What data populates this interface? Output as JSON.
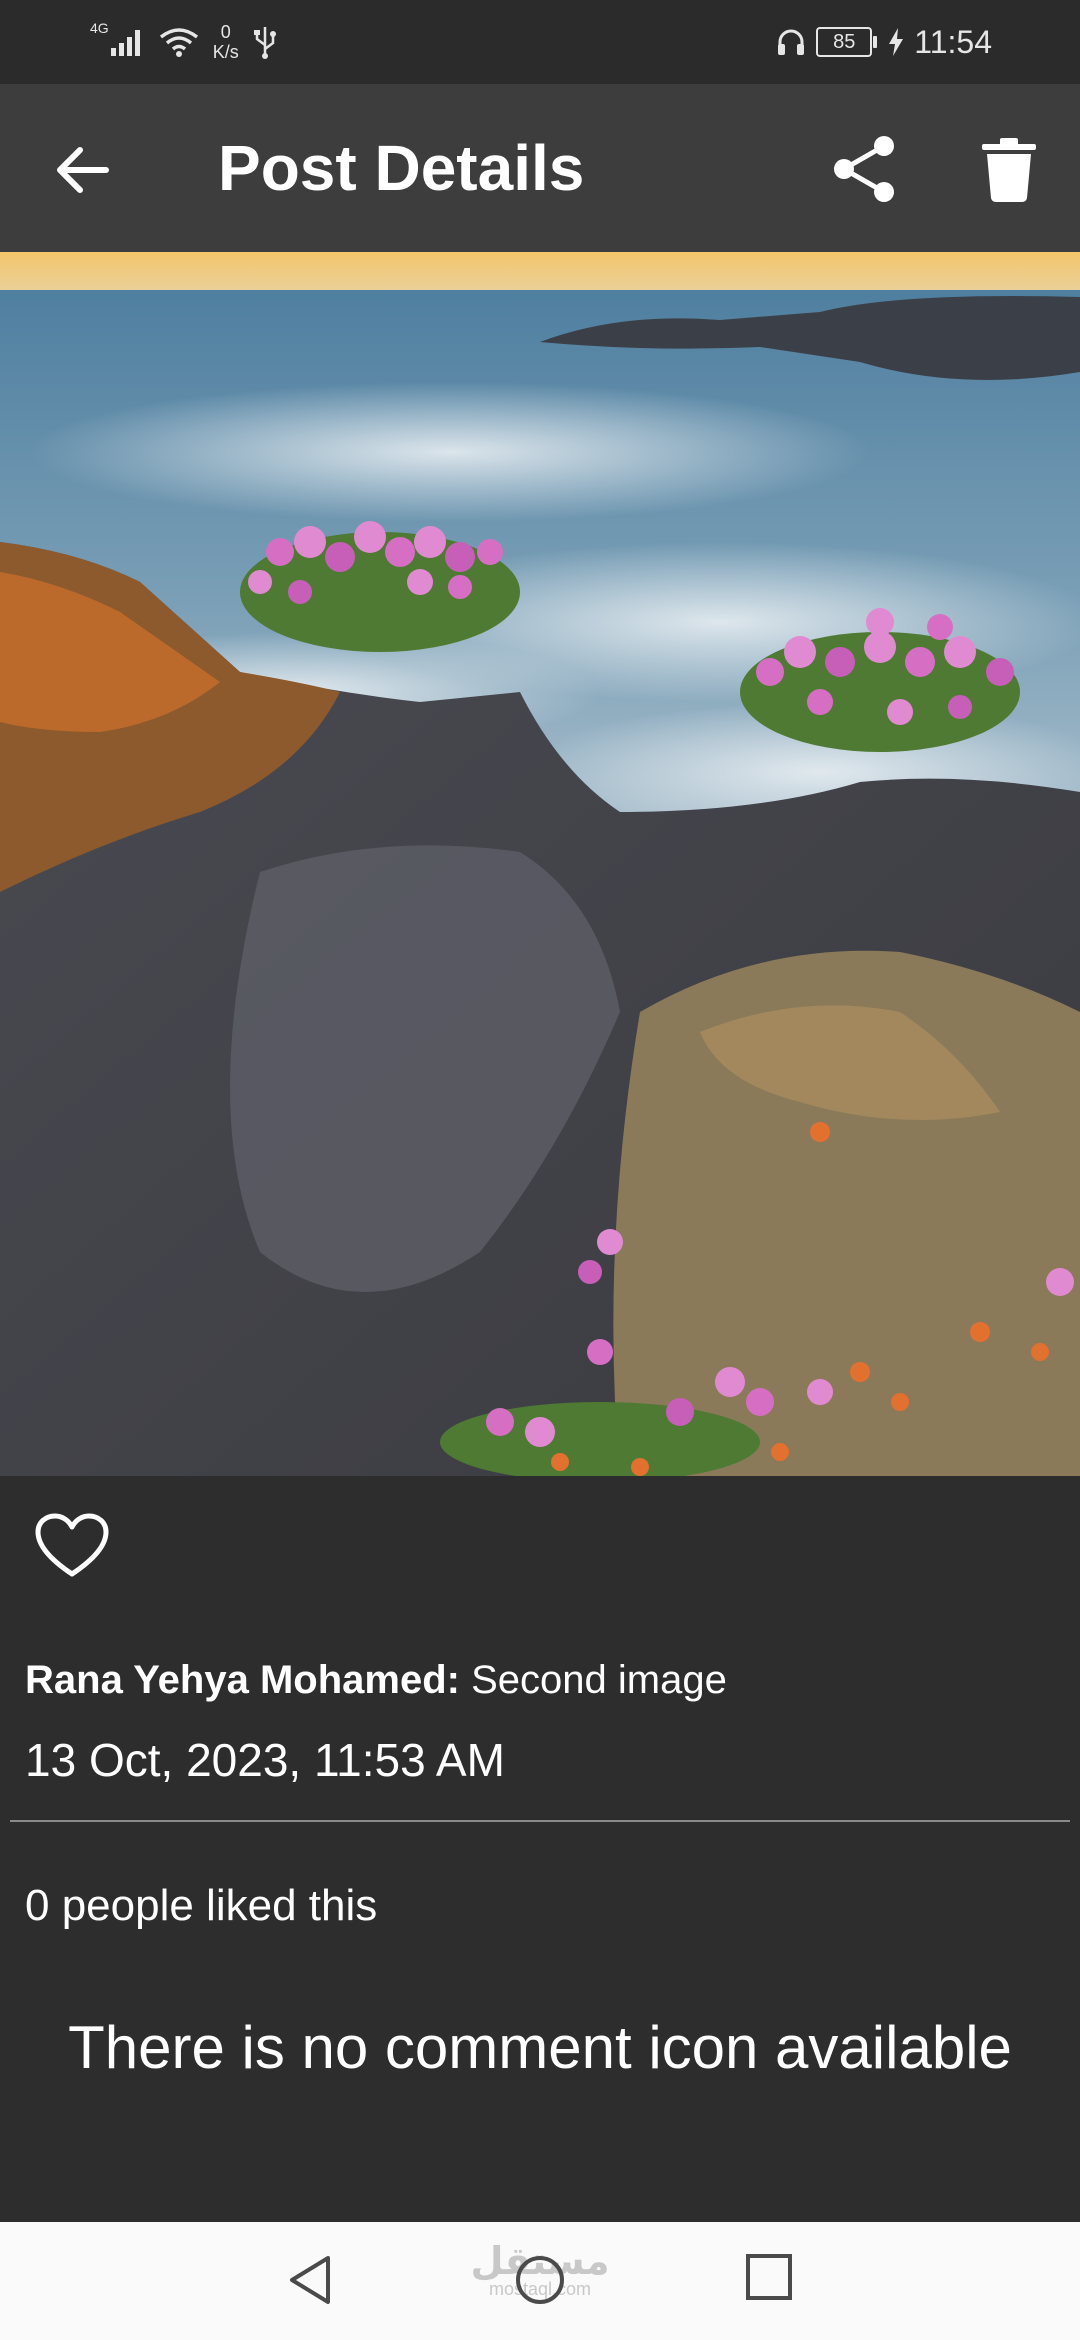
{
  "status_bar": {
    "network_type": "4G",
    "net_speed_value": "0",
    "net_speed_unit": "K/s",
    "battery_level": "85",
    "time": "11:54",
    "icons": [
      "signal-icon",
      "wifi-icon",
      "usb-icon",
      "headphones-icon",
      "battery-icon",
      "charging-icon"
    ]
  },
  "app_bar": {
    "title": "Post Details",
    "icons": [
      "back-arrow-icon",
      "share-icon",
      "trash-icon"
    ]
  },
  "post": {
    "image_description_icon": "landscape-photo",
    "author": "Rana Yehya Mohamed:",
    "caption": "Second image",
    "date": "13 Oct, 2023, 11:53 AM",
    "likes_text": "0 people liked this",
    "comments_text": "There is no comment icon available"
  },
  "nav_bar": {
    "icons": [
      "nav-back-icon",
      "nav-home-icon",
      "nav-recent-icon"
    ],
    "watermark_ar": "مستقل",
    "watermark_en": "mostaql.com"
  },
  "colors": {
    "background": "#2d2d2d",
    "app_bar": "#3d3d3d",
    "status_bar": "#2b2b2b",
    "nav_bar": "#fafafa",
    "text": "#ffffff"
  }
}
